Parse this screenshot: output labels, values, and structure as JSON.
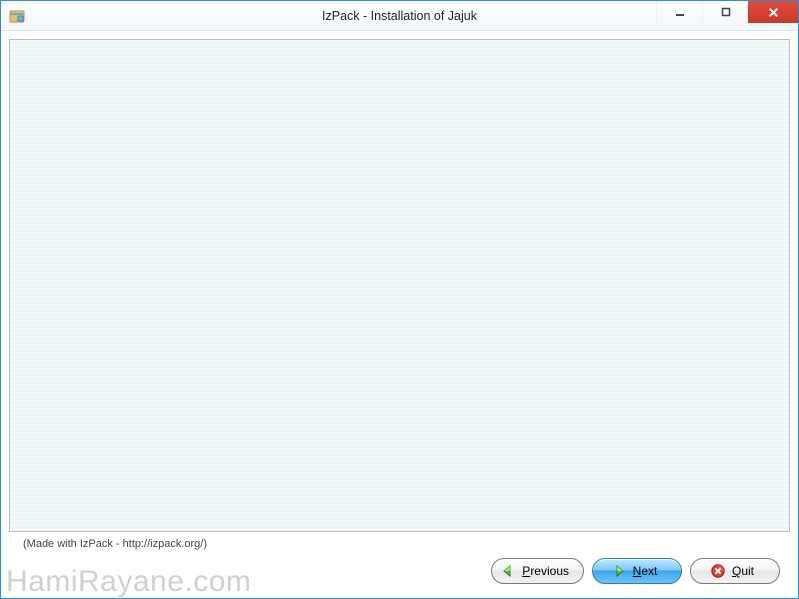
{
  "titlebar": {
    "title": "IzPack - Installation of Jajuk"
  },
  "footer": {
    "credit": "(Made with IzPack - http://izpack.org/)"
  },
  "buttons": {
    "previous": {
      "prefix": "P",
      "rest": "revious"
    },
    "next": {
      "prefix": "N",
      "rest": "ext"
    },
    "quit": {
      "prefix": "Q",
      "rest": "uit"
    }
  },
  "watermark": "HamiRayane.com"
}
